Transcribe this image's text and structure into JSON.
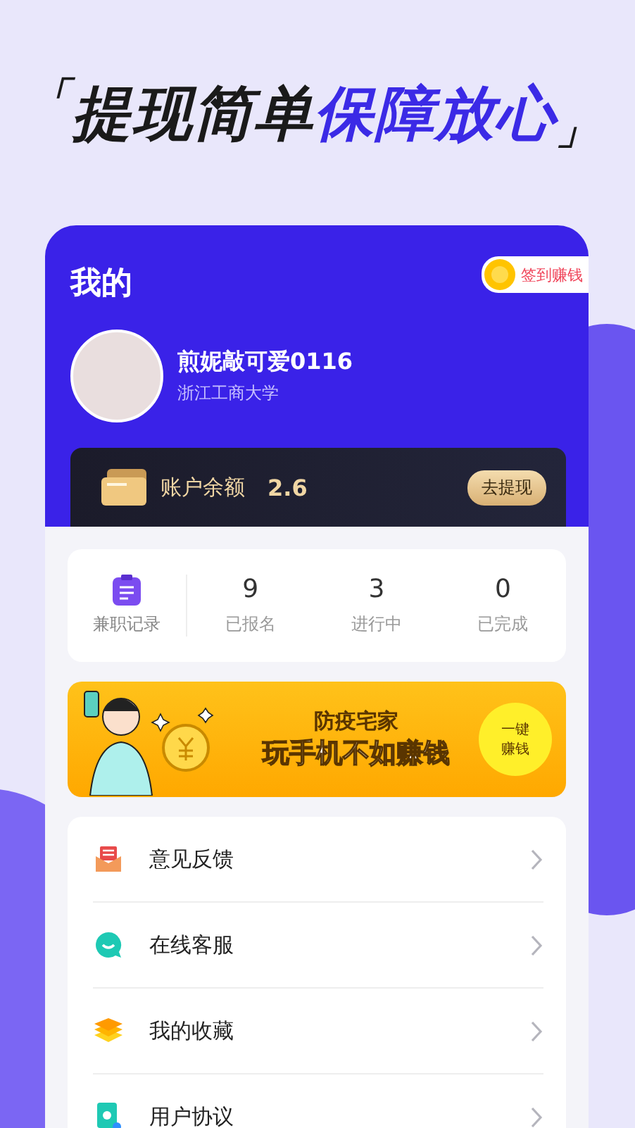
{
  "headline": {
    "open_bracket": "「",
    "plain": "提现简单",
    "highlight": "保障放心",
    "close_bracket": "」"
  },
  "header": {
    "title": "我的",
    "checkin_button": "签到赚钱"
  },
  "profile": {
    "name": "煎妮敲可爱0116",
    "school": "浙江工商大学"
  },
  "balance": {
    "label": "账户余额",
    "amount": "2.6",
    "button": "去提现"
  },
  "records": {
    "label": "兼职记录",
    "stats": [
      {
        "value": "9",
        "label": "已报名"
      },
      {
        "value": "3",
        "label": "进行中"
      },
      {
        "value": "0",
        "label": "已完成"
      }
    ]
  },
  "banner": {
    "subtitle": "防疫宅家",
    "title": "玩手机不如赚钱",
    "button_line1": "一键",
    "button_line2": "赚钱"
  },
  "menu": [
    {
      "kind": "feedback",
      "label": "意见反馈"
    },
    {
      "kind": "service",
      "label": "在线客服"
    },
    {
      "kind": "favorites",
      "label": "我的收藏"
    },
    {
      "kind": "agreement",
      "label": "用户协议"
    }
  ]
}
